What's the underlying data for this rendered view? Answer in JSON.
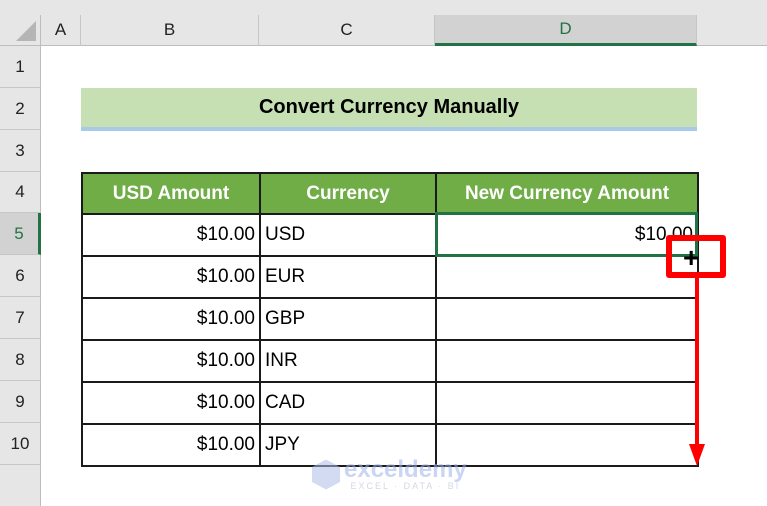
{
  "spreadsheet": {
    "columns": [
      "A",
      "B",
      "C",
      "D"
    ],
    "selected_column": "D",
    "rows": [
      "1",
      "2",
      "3",
      "4",
      "5",
      "6",
      "7",
      "8",
      "9",
      "10"
    ],
    "selected_row": "5",
    "title": "Convert Currency Manually",
    "table": {
      "headers": [
        "USD Amount",
        "Currency",
        "New Currency Amount"
      ],
      "rows": [
        {
          "usd": "$10.00",
          "currency": "USD",
          "new": "$10.00"
        },
        {
          "usd": "$10.00",
          "currency": "EUR",
          "new": ""
        },
        {
          "usd": "$10.00",
          "currency": "GBP",
          "new": ""
        },
        {
          "usd": "$10.00",
          "currency": "INR",
          "new": ""
        },
        {
          "usd": "$10.00",
          "currency": "CAD",
          "new": ""
        },
        {
          "usd": "$10.00",
          "currency": "JPY",
          "new": ""
        }
      ]
    },
    "active_cell": "D5",
    "fill_handle_cursor": "+"
  },
  "annotation": {
    "color": "#ff0000",
    "description": "drag fill handle down to D10"
  },
  "watermark": {
    "name": "exceldemy",
    "tagline": "EXCEL · DATA · BI"
  },
  "colors": {
    "header_green": "#70ad47",
    "title_green": "#c6e0b4",
    "selection_green": "#217346"
  }
}
